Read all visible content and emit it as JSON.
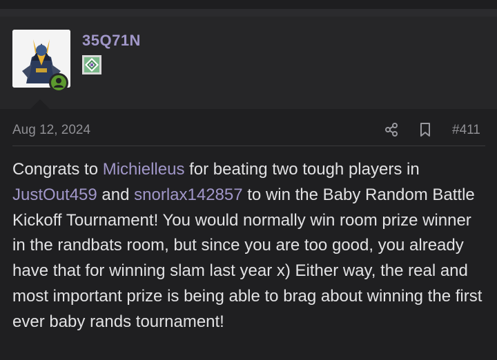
{
  "post": {
    "username": "35Q71N",
    "date": "Aug 12, 2024",
    "post_number": "#411",
    "icons": [
      "share-icon",
      "bookmark-icon",
      "online-status-icon",
      "user-badge-icon"
    ],
    "colors": {
      "background": "#1f1f21",
      "user_block": "#262628",
      "username": "#a197c9",
      "text": "#e2e2e4",
      "meta": "#8f8f94",
      "online": "#5c9a2e"
    },
    "message": {
      "seg1": "Congrats to ",
      "mention1": "Michielleus",
      "seg2": " for beating two tough players in ",
      "mention2": "JustOut459",
      "seg3": " and ",
      "mention3": "snorlax142857",
      "seg4": " to win the Baby Random Battle Kickoff Tournament! You would normally win room prize winner in the randbats room, but since you are too good, you already have that for winning slam last year x) Either way, the real and most important prize is being able to brag about winning the first ever baby rands tournament!"
    }
  }
}
